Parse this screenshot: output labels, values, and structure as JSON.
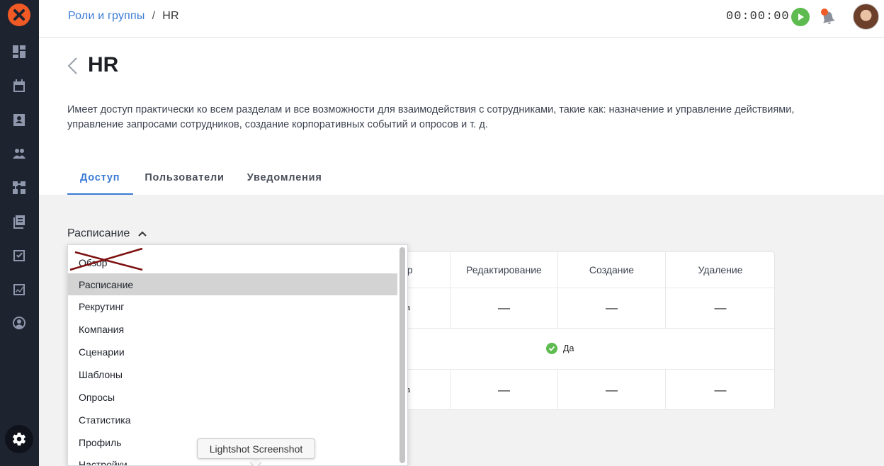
{
  "header": {
    "breadcrumb_parent": "Роли и группы",
    "breadcrumb_separator": "/",
    "breadcrumb_current": "HR",
    "timer": "00:00:00"
  },
  "page": {
    "title": "HR",
    "description": "Имеет доступ практически ко всем разделам и все возможности для взаимодействия с сотрудниками, такие как: назначение и управление действиями, управление запросами сотрудников, создание корпоративных событий и опросов и т. д."
  },
  "tabs": [
    {
      "label": "Доступ",
      "active": true
    },
    {
      "label": "Пользователи",
      "active": false
    },
    {
      "label": "Уведомления",
      "active": false
    }
  ],
  "section": {
    "title": "Расписание"
  },
  "table": {
    "headers": [
      "отр",
      "Редактирование",
      "Создание",
      "Удаление"
    ],
    "rows": [
      {
        "first": "а",
        "cells": [
          "—",
          "—",
          "—"
        ]
      },
      {
        "merged": "Да"
      },
      {
        "first": "а",
        "cells": [
          "—",
          "—",
          "—"
        ]
      }
    ]
  },
  "dropdown": {
    "items": [
      "Обзор",
      "Расписание",
      "Рекрутинг",
      "Компания",
      "Сценарии",
      "Шаблоны",
      "Опросы",
      "Статистика",
      "Профиль",
      "Настройки"
    ],
    "selected_index": 1,
    "struck_index": 0
  },
  "tooltip": "Lightshot Screenshot",
  "colors": {
    "accent": "#3a7bd5",
    "brand": "#f15a24",
    "success": "#5dbb4f",
    "sidebar": "#1e2330"
  }
}
